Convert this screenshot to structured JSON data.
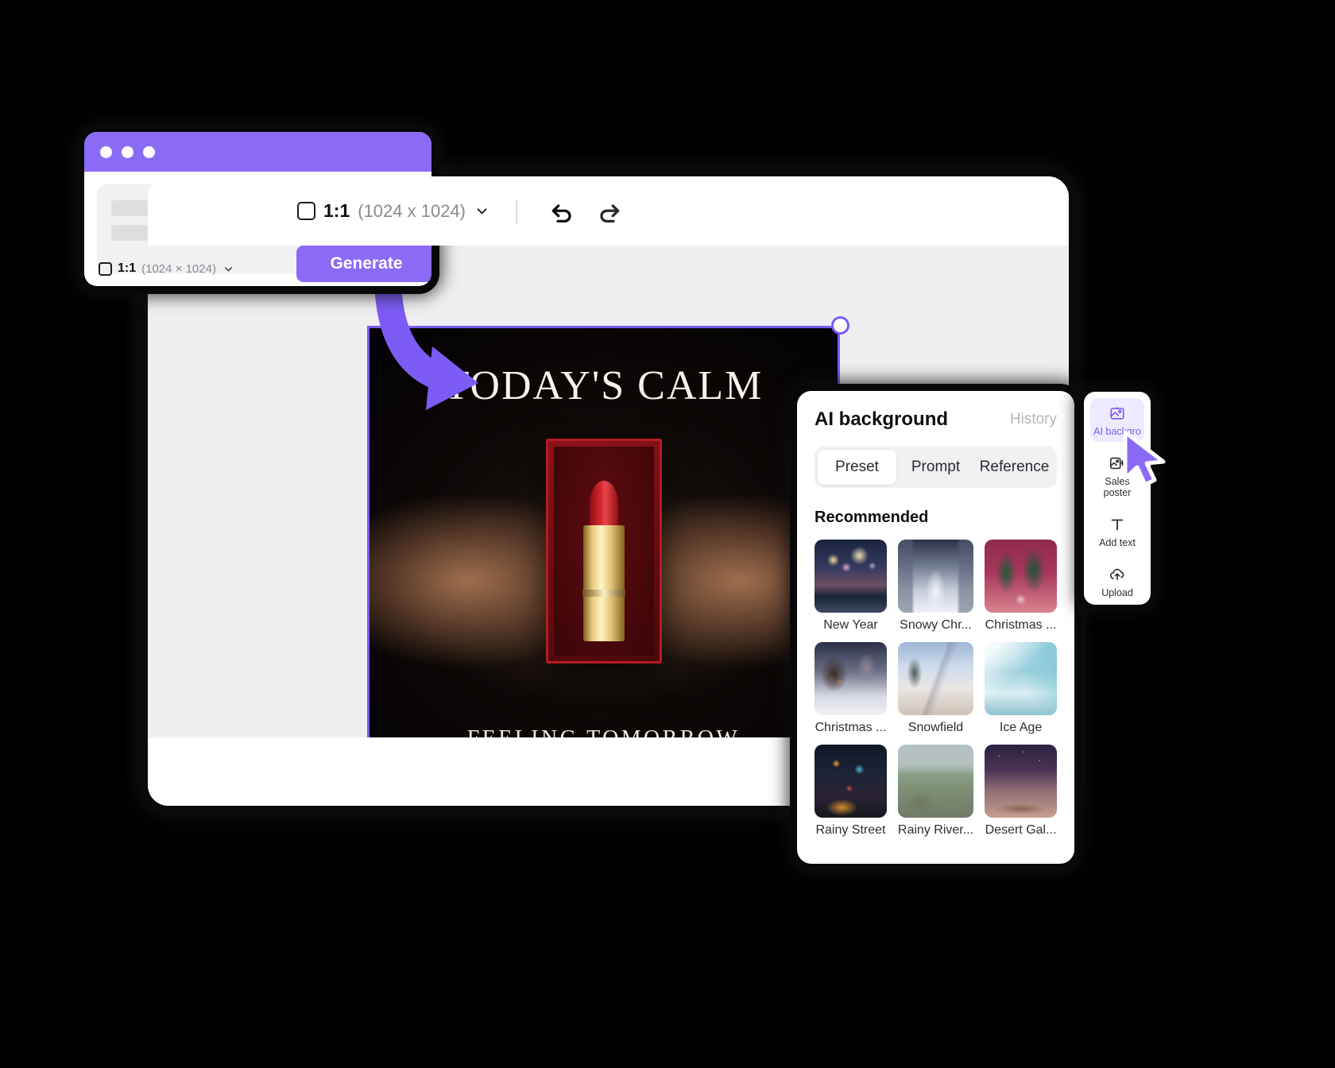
{
  "generate_card": {
    "window_dots": [
      "dot-red",
      "dot-yellow",
      "dot-green"
    ],
    "text_icon": "T",
    "ratio": {
      "label": "1:1",
      "dims": "(1024 × 1024)",
      "chevron_icon": "chevron-down-icon"
    },
    "generate_label": "Generate"
  },
  "editor": {
    "toolbar": {
      "ratio": {
        "label": "1:1",
        "dims": "(1024 x 1024)",
        "chevron_icon": "chevron-down-icon"
      },
      "undo_icon": "undo-icon",
      "redo_icon": "redo-icon"
    },
    "artwork": {
      "title": "TODAY'S CALM",
      "subtitle": "FEELING TOMORROW",
      "product": "red lipstick in gift box"
    }
  },
  "ai_background": {
    "title": "AI background",
    "history_label": "History",
    "tabs": [
      {
        "label": "Preset",
        "active": true
      },
      {
        "label": "Prompt",
        "active": false
      },
      {
        "label": "Reference",
        "active": false
      }
    ],
    "section_title": "Recommended",
    "thumbnails": [
      {
        "label": "New Year",
        "style": "t-newyear"
      },
      {
        "label": "Snowy Chr...",
        "style": "t-snowychr"
      },
      {
        "label": "Christmas ...",
        "style": "t-christmas1"
      },
      {
        "label": "Christmas ...",
        "style": "t-christmas2"
      },
      {
        "label": "Snowfield",
        "style": "t-snowfield"
      },
      {
        "label": "Ice Age",
        "style": "t-iceage"
      },
      {
        "label": "Rainy Street",
        "style": "t-rainystreet"
      },
      {
        "label": "Rainy River...",
        "style": "t-rainyriver"
      },
      {
        "label": "Desert Gal...",
        "style": "t-desertgal"
      }
    ]
  },
  "tool_rail": {
    "items": [
      {
        "label": "AI backgro",
        "icon": "ai-background-icon",
        "active": true
      },
      {
        "label": "Sales poster",
        "icon": "sales-poster-icon",
        "active": false
      },
      {
        "label": "Add text",
        "icon": "add-text-icon",
        "active": false
      },
      {
        "label": "Upload",
        "icon": "upload-icon",
        "active": false
      }
    ]
  },
  "colors": {
    "accent": "#7c5cf5",
    "accent_light": "#8b6bf6",
    "canvas_bg": "#efeff1"
  }
}
